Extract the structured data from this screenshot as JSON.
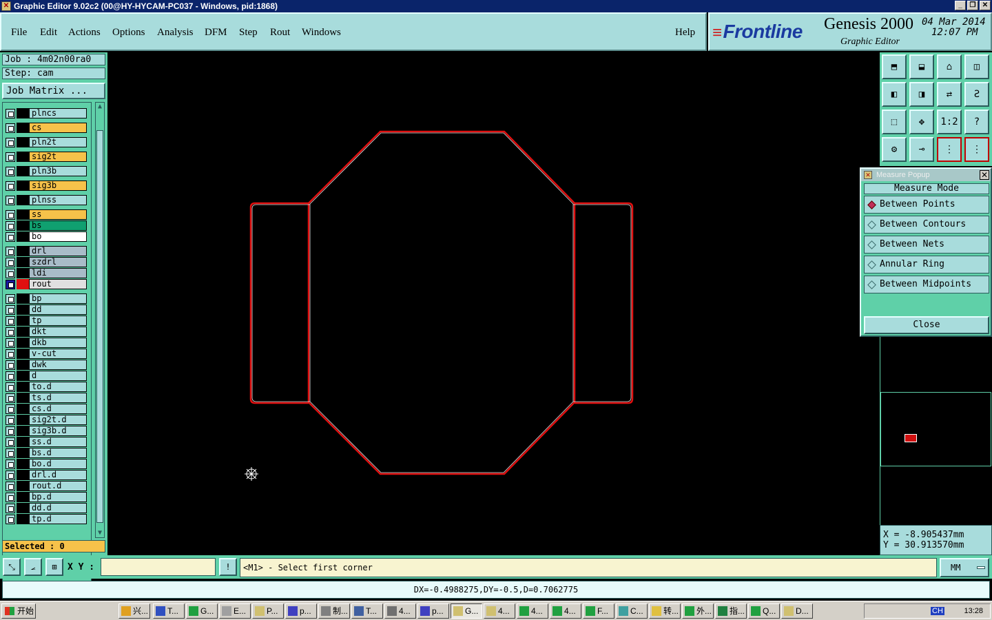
{
  "window": {
    "title": "Graphic Editor 9.02c2 (00@HY-HYCAM-PC037 - Windows, pid:1868)"
  },
  "menu": {
    "items": [
      "File",
      "Edit",
      "Actions",
      "Options",
      "Analysis",
      "DFM",
      "Step",
      "Rout",
      "Windows"
    ],
    "help": "Help"
  },
  "logo": {
    "brand": "Frontline",
    "product": "Genesis 2000",
    "subtitle": "Graphic Editor",
    "date": "04 Mar 2014",
    "time": "12:07 PM"
  },
  "job": {
    "job_line": "Job : 4m02n00ra0",
    "step_line": "Step: cam",
    "matrix_button": "Job Matrix ...",
    "selected": "Selected : 0"
  },
  "layers": [
    {
      "name": "plncs",
      "color": "#a8dcdc"
    },
    {
      "name": "cs",
      "color": "#f6c24a"
    },
    {
      "name": "pln2t",
      "color": "#a8dcdc"
    },
    {
      "name": "sig2t",
      "color": "#f6c24a"
    },
    {
      "name": "pln3b",
      "color": "#a8dcdc"
    },
    {
      "name": "sig3b",
      "color": "#f6c24a"
    },
    {
      "name": "plnss",
      "color": "#a8dcdc"
    },
    {
      "name": "ss",
      "color": "#f6c24a"
    },
    {
      "name": "bs",
      "color": "#10a070"
    },
    {
      "name": "bo",
      "color": "#ffffff"
    },
    {
      "name": "drl",
      "color": "#a8bcc8"
    },
    {
      "name": "szdrl",
      "color": "#a8bcc8"
    },
    {
      "name": "ldi",
      "color": "#a8bcc8"
    },
    {
      "name": "rout",
      "color": "#e0e0e0",
      "active": true
    },
    {
      "name": "bp",
      "color": "#a8dcdc"
    },
    {
      "name": "dd",
      "color": "#a8dcdc"
    },
    {
      "name": "tp",
      "color": "#a8dcdc"
    },
    {
      "name": "dkt",
      "color": "#a8dcdc"
    },
    {
      "name": "dkb",
      "color": "#a8dcdc"
    },
    {
      "name": "v-cut",
      "color": "#a8dcdc"
    },
    {
      "name": "dwk",
      "color": "#a8dcdc"
    },
    {
      "name": "d",
      "color": "#a8dcdc"
    },
    {
      "name": "to.d",
      "color": "#a8dcdc"
    },
    {
      "name": "ts.d",
      "color": "#a8dcdc"
    },
    {
      "name": "cs.d",
      "color": "#a8dcdc"
    },
    {
      "name": "sig2t.d",
      "color": "#a8dcdc"
    },
    {
      "name": "sig3b.d",
      "color": "#a8dcdc"
    },
    {
      "name": "ss.d",
      "color": "#a8dcdc"
    },
    {
      "name": "bs.d",
      "color": "#a8dcdc"
    },
    {
      "name": "bo.d",
      "color": "#a8dcdc"
    },
    {
      "name": "drl.d",
      "color": "#a8dcdc"
    },
    {
      "name": "rout.d",
      "color": "#a8dcdc"
    },
    {
      "name": "bp.d",
      "color": "#a8dcdc"
    },
    {
      "name": "dd.d",
      "color": "#a8dcdc"
    },
    {
      "name": "tp.d",
      "color": "#a8dcdc"
    }
  ],
  "tools": [
    "home-icon",
    "down-icon",
    "house-icon",
    "window-icon",
    "left-icon",
    "right-icon",
    "flip-icon",
    "s-icon",
    "fit-icon",
    "zoom-icon",
    "scale-icon",
    "help-icon",
    "route-icon",
    "probe-icon",
    "net-icon",
    "net-red-icon"
  ],
  "tool_labels": {
    "scale": "1:2",
    "help": "?"
  },
  "measure": {
    "title": "Measure Popup",
    "header": "Measure Mode",
    "options": [
      "Between Points",
      "Between Contours",
      "Between Nets",
      "Annular Ring",
      "Between Midpoints"
    ],
    "selected_index": 0,
    "close": "Close"
  },
  "coords": {
    "x": "X = -8.905437mm",
    "y": "Y = 30.913570mm"
  },
  "command": {
    "xy_label": "X Y :",
    "xy_value": "",
    "prompt": "<M1> - Select first corner",
    "units": "MM"
  },
  "result": "DX=-0.4988275,DY=-0.5,D=0.7062775",
  "taskbar": {
    "start": "开始",
    "items": [
      "兴...",
      "T...",
      "G...",
      "E...",
      "P...",
      "p...",
      "制...",
      "T...",
      "4...",
      "p...",
      "G...",
      "4...",
      "4...",
      "4...",
      "F...",
      "C...",
      "转...",
      "外...",
      "指...",
      "Q...",
      "D..."
    ],
    "active_index": 10,
    "tray_lang": "CH",
    "clock": "13:28"
  },
  "colors": {
    "route_outline": "#e01010",
    "panel": "#a8dcdc",
    "panel_bg": "#5fd0a8"
  }
}
